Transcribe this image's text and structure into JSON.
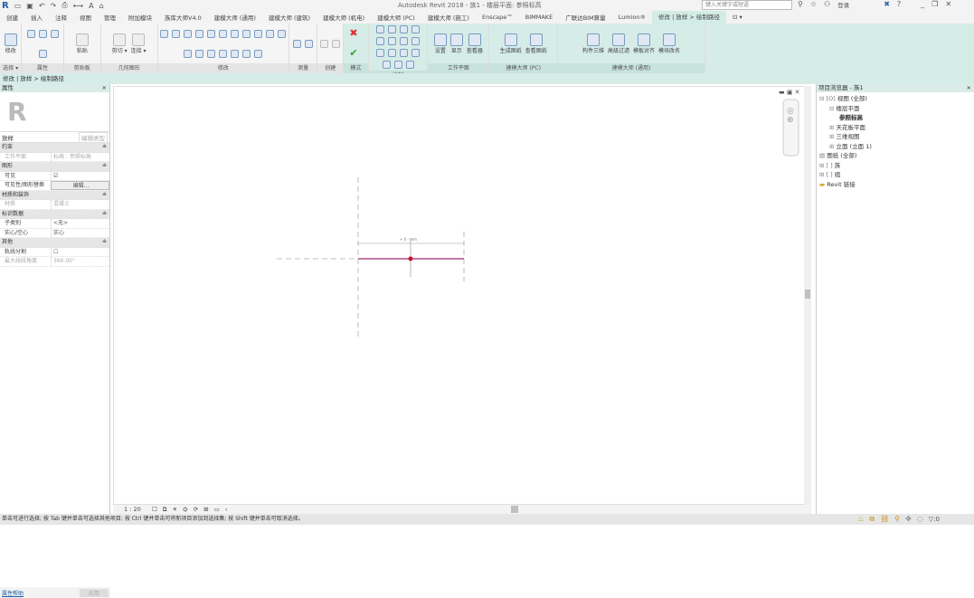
{
  "titlebar": {
    "title": "Autodesk Revit 2018 -   族1 - 楼层平面: 参照标高",
    "search_placeholder": "键入关键字或短语",
    "login": "登录"
  },
  "tabs": [
    "创建",
    "插入",
    "注释",
    "视图",
    "管理",
    "附加模块",
    "族库大师V4.0",
    "建模大师 (通用)",
    "建模大师 (建筑)",
    "建模大师 (机电)",
    "建模大师 (PC)",
    "建模大师 (施工)",
    "Enscape™",
    "BIMMAKE",
    "广联达BIM算量",
    "Lumion®",
    "修改 | 放样 > 绘制路径",
    "⊡ ▾"
  ],
  "ribbon": {
    "panels": [
      {
        "label": "选择 ▾",
        "tools": [
          "修改"
        ]
      },
      {
        "label": "属性",
        "tools": []
      },
      {
        "label": "剪贴板",
        "tools": [
          "粘贴"
        ]
      },
      {
        "label": "几何图形",
        "tools": [
          "剪切 ▾",
          "连接 ▾"
        ]
      },
      {
        "label": "修改",
        "tools": []
      },
      {
        "label": "测量",
        "tools": []
      },
      {
        "label": "创建",
        "tools": []
      },
      {
        "label": "模式",
        "tools": []
      },
      {
        "label": "绘制",
        "tools": []
      },
      {
        "label": "工作平面",
        "tools": [
          "设置",
          "显示",
          "查看器"
        ]
      },
      {
        "label": "建模大师 (PC)",
        "tools": [
          "生成图纸",
          "查看图纸"
        ]
      },
      {
        "label": "建模大师 (通用)",
        "tools": [
          "构件三维",
          "高级过滤",
          "模板对齐",
          "模块改名"
        ]
      }
    ]
  },
  "optbar": "修改 | 放样 > 绘制路径",
  "properties": {
    "title": "属性",
    "type": "放样",
    "edit_type": "编辑类型",
    "groups": [
      {
        "name": "约束",
        "rows": [
          {
            "k": "工作平面",
            "v": "标高 : 参照标高",
            "dim": true
          }
        ]
      },
      {
        "name": "图形",
        "rows": [
          {
            "k": "可见",
            "v": "☑"
          },
          {
            "k": "可见性/图形替换",
            "v": "编辑..."
          }
        ]
      },
      {
        "name": "材质和装饰",
        "rows": [
          {
            "k": "材质",
            "v": "混凝土",
            "dim": true
          }
        ]
      },
      {
        "name": "标识数据",
        "rows": [
          {
            "k": "子类别",
            "v": "<无>"
          },
          {
            "k": "实心/空心",
            "v": "实心"
          }
        ]
      },
      {
        "name": "其他",
        "rows": [
          {
            "k": "轨线分割",
            "v": "☐"
          },
          {
            "k": "最大线段角度",
            "v": "360.00°",
            "dim": true
          }
        ]
      }
    ],
    "help_link": "属性帮助",
    "apply": "应用"
  },
  "browser": {
    "title": "项目浏览器 - 族1",
    "items": [
      {
        "label": "视图 (全部)",
        "depth": 0,
        "exp": "⊟",
        "icon": "[O]"
      },
      {
        "label": "楼层平面",
        "depth": 1,
        "exp": "⊟"
      },
      {
        "label": "参照标高",
        "depth": 2,
        "bold": true
      },
      {
        "label": "天花板平面",
        "depth": 1,
        "exp": "⊞"
      },
      {
        "label": "三维视图",
        "depth": 1,
        "exp": "⊞"
      },
      {
        "label": "立面 (立面 1)",
        "depth": 1,
        "exp": "⊞"
      },
      {
        "label": "图纸 (全部)",
        "depth": 0,
        "exp": " ",
        "icon": "▤"
      },
      {
        "label": "族",
        "depth": 0,
        "exp": "⊞",
        "icon": "[ ]"
      },
      {
        "label": "组",
        "depth": 0,
        "exp": "⊞",
        "icon": "[ ]"
      },
      {
        "label": "Revit 链接",
        "depth": 0,
        "exp": " ",
        "icon": "▬"
      }
    ]
  },
  "canvas": {
    "dimension": "+ 0 - mm"
  },
  "viewctl": {
    "scale": "1 : 20"
  },
  "status": {
    "text": "单击可进行选择; 按 Tab 键并单击可选择其他项目; 按 Ctrl 键并单击可将新项目添加到选择集; 按 Shift 键并单击可取消选择。",
    "filter": "▽:0"
  },
  "colors": {
    "context": "#d5ece7",
    "path": "#9c2a6e",
    "point": "#d0102a"
  }
}
